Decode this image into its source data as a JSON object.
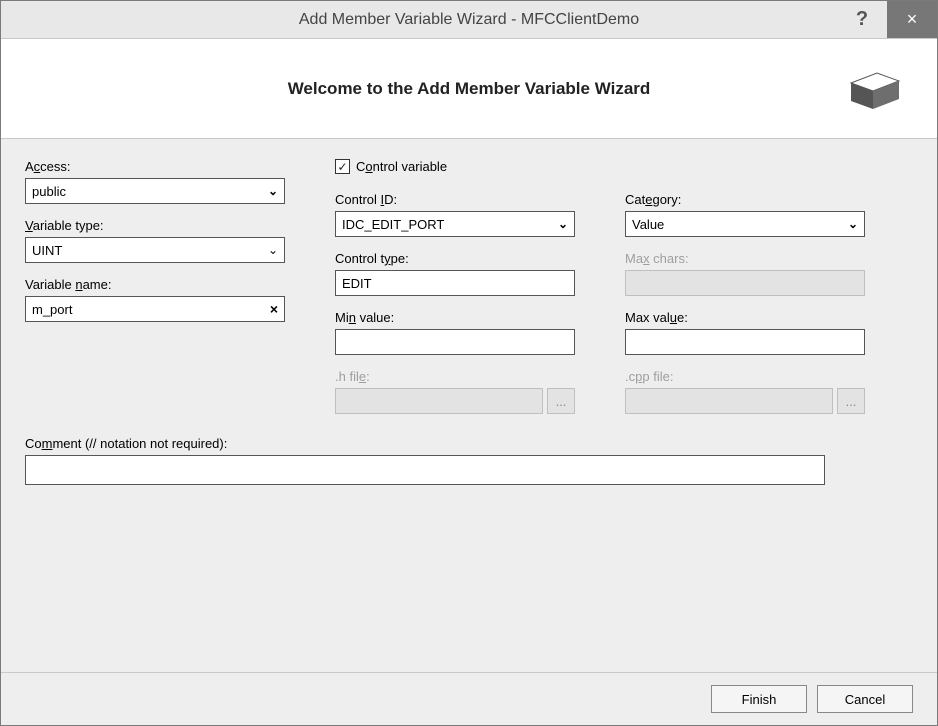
{
  "titlebar": {
    "title": "Add Member Variable Wizard - MFCClientDemo",
    "help": "?",
    "close": "×"
  },
  "header": {
    "title": "Welcome to the Add Member Variable Wizard"
  },
  "left": {
    "access_label_pre": "A",
    "access_label_u": "c",
    "access_label_post": "cess:",
    "access_value": "public",
    "vartype_label_u": "V",
    "vartype_label_post": "ariable type:",
    "vartype_value": "UINT",
    "varname_label_pre": "Variable ",
    "varname_label_u": "n",
    "varname_label_post": "ame:",
    "varname_value": "m_port"
  },
  "mid": {
    "control_variable_checked": "✓",
    "control_variable_label_pre": "C",
    "control_variable_label_u": "o",
    "control_variable_label_post": "ntrol variable",
    "control_id_label_pre": "Control ",
    "control_id_label_u": "I",
    "control_id_label_post": "D:",
    "control_id_value": "IDC_EDIT_PORT",
    "control_type_label_pre": "Control t",
    "control_type_label_u": "y",
    "control_type_label_post": "pe:",
    "control_type_value": "EDIT",
    "min_value_label_pre": "Mi",
    "min_value_label_u": "n",
    "min_value_label_post": " value:",
    "min_value_value": "",
    "hfile_label_pre": ".h fil",
    "hfile_label_u": "e",
    "hfile_label_post": ":",
    "hfile_value": ""
  },
  "right": {
    "category_label_pre": "Cat",
    "category_label_u": "e",
    "category_label_post": "gory:",
    "category_value": "Value",
    "max_chars_label_pre": "Ma",
    "max_chars_label_u": "x",
    "max_chars_label_post": " chars:",
    "max_chars_value": "",
    "max_value_label_pre": "Max val",
    "max_value_label_u": "u",
    "max_value_label_post": "e:",
    "max_value_value": "",
    "cppfile_label_pre": ".c",
    "cppfile_label_u": "p",
    "cppfile_label_post": "p file:",
    "cppfile_value": ""
  },
  "comment": {
    "label_pre": "Co",
    "label_u": "m",
    "label_post": "ment (// notation not required):",
    "value": ""
  },
  "footer": {
    "finish": "Finish",
    "cancel": "Cancel"
  },
  "browse": "..."
}
